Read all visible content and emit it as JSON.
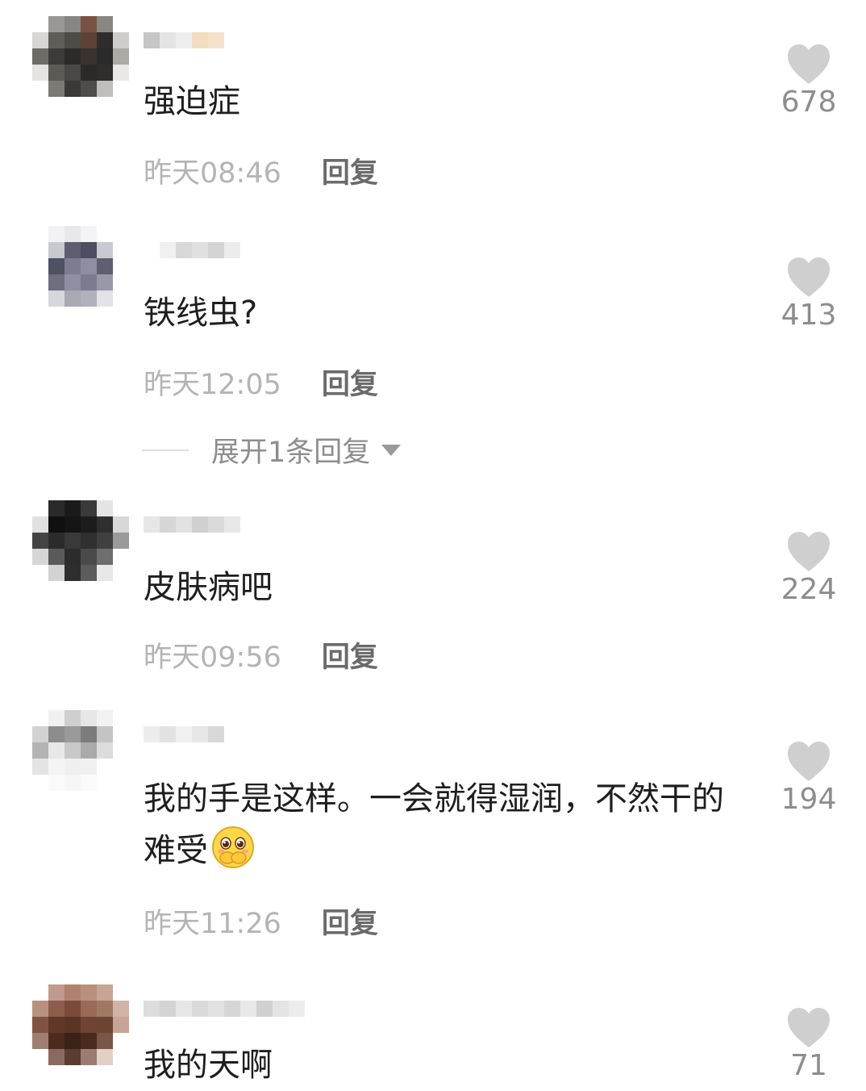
{
  "comments": [
    {
      "text": "强迫症",
      "time": "昨天08:46",
      "reply_label": "回复",
      "likes": "678",
      "avatar_colors": [
        "#ffffff",
        "#9a9895",
        "#888682",
        "#7a5244",
        "#8a8782",
        "#ffffff",
        "#d8d6d2",
        "#5f5d58",
        "#4d4b46",
        "#5e4237",
        "#2e2d2b",
        "#cfcdca",
        "#6f6c66",
        "#3d3b37",
        "#2c2b28",
        "#3a3230",
        "#2a2a2a",
        "#adaaa6",
        "#e6e4e2",
        "#5c5a55",
        "#4a4845",
        "#2b2a29",
        "#2f2e2d",
        "#e9e8e6",
        "#ffffff",
        "#7d7a75",
        "#3a3937",
        "#4f4d4a",
        "#c0beba",
        "#ffffff",
        "#ffffff",
        "#ffffff",
        "#ffffff",
        "#ffffff",
        "#ffffff",
        "#ffffff"
      ],
      "name_colors": [
        "#c7c6c6",
        "#e4e4e4",
        "#eeeeee",
        "#f4dcc0",
        "#f6e2cb"
      ]
    },
    {
      "text": "铁线虫?",
      "time": "昨天12:05",
      "reply_label": "回复",
      "likes": "413",
      "avatar_colors": [
        "#ffffff",
        "#f2f2f4",
        "#e8e8ec",
        "#f4f4f6",
        "#ffffff",
        "#ffffff",
        "#ffffff",
        "#c8c8d0",
        "#5c5d6e",
        "#4d4f60",
        "#c9c9d1",
        "#ffffff",
        "#ffffff",
        "#4e5064",
        "#7c7d8e",
        "#8d8ea0",
        "#5e6072",
        "#ffffff",
        "#ffffff",
        "#6d6e80",
        "#8e8fa0",
        "#7b7c90",
        "#9899a8",
        "#ffffff",
        "#ffffff",
        "#d6d6dd",
        "#a9a9b6",
        "#b1b1bd",
        "#e2e2e8",
        "#ffffff",
        "#ffffff",
        "#ffffff",
        "#ffffff",
        "#ffffff",
        "#ffffff",
        "#ffffff"
      ],
      "name_colors": [
        "#ffffff",
        "#f0f0f0",
        "#d8d8d8",
        "#e0e0e0",
        "#d4d4d4",
        "#ececec"
      ]
    },
    {
      "text": "皮肤病吧",
      "time": "昨天09:56",
      "reply_label": "回复",
      "likes": "224",
      "avatar_colors": [
        "#ffffff",
        "#2a2a2a",
        "#1a1a1a",
        "#3a3a3a",
        "#e4e4e4",
        "#ffffff",
        "#e1e1e1",
        "#101010",
        "#151515",
        "#1c1c1c",
        "#2f2f2f",
        "#d8d8d8",
        "#444444",
        "#2b2b2b",
        "#3a3a3a",
        "#303030",
        "#404040",
        "#9a9a9a",
        "#d6d6d6",
        "#5a5a5a",
        "#2c2c2c",
        "#4a4a4a",
        "#6e6e6e",
        "#ffffff",
        "#ffffff",
        "#d2d2d2",
        "#2e2e2e",
        "#5c5c5c",
        "#e8e8e8",
        "#ffffff",
        "#ffffff",
        "#ffffff",
        "#ffffff",
        "#ffffff",
        "#ffffff",
        "#ffffff"
      ],
      "name_colors": [
        "#e6e6e6",
        "#d6d6d6",
        "#e2e2e2",
        "#d0d0d0",
        "#dadada",
        "#e8e8e8"
      ]
    },
    {
      "text": "我的手是这样。一会就得湿润，不然干的难受",
      "time": "昨天11:26",
      "reply_label": "回复",
      "likes": "194",
      "avatar_colors": [
        "#ffffff",
        "#f0f0f0",
        "#cfcfcf",
        "#e6e6e6",
        "#f2f2f2",
        "#ffffff",
        "#d2d2d2",
        "#8c8c8c",
        "#9a9a9a",
        "#7c7c7c",
        "#c4c4c4",
        "#ffffff",
        "#b4b4b4",
        "#e8e8e8",
        "#c8c8c8",
        "#aaaaaa",
        "#dcdcdc",
        "#ffffff",
        "#e4e4e4",
        "#f4f4f4",
        "#efefef",
        "#f0f0f0",
        "#ffffff",
        "#ffffff",
        "#ffffff",
        "#fafafa",
        "#f6f6f6",
        "#fafafa",
        "#ffffff",
        "#ffffff",
        "#ffffff",
        "#ffffff",
        "#ffffff",
        "#ffffff",
        "#ffffff",
        "#ffffff"
      ],
      "name_colors": [
        "#ececec",
        "#e2e2e2",
        "#f0f0f0",
        "#e6e6e6",
        "#d8d8d8"
      ]
    },
    {
      "text": "我的天啊",
      "time": "",
      "reply_label": "",
      "likes": "71",
      "avatar_colors": [
        "#ffffff",
        "#c09a8c",
        "#b08070",
        "#b8907e",
        "#c8a494",
        "#ffffff",
        "#b9917f",
        "#8c5c4c",
        "#7a4a3a",
        "#9a6a58",
        "#a07866",
        "#d0b4a8",
        "#805444",
        "#603828",
        "#5a3424",
        "#704434",
        "#6c4434",
        "#c8a496",
        "#a07e70",
        "#4c2a1e",
        "#3a2218",
        "#4a2a1e",
        "#7a5646",
        "#ffffff",
        "#ffffff",
        "#8a6a5e",
        "#5a3c30",
        "#9a7c70",
        "#e0d0c8",
        "#ffffff",
        "#ffffff",
        "#ffffff",
        "#ffffff",
        "#ffffff",
        "#ffffff",
        "#ffffff"
      ],
      "name_colors": [
        "#dcdcdc",
        "#d4d4d4",
        "#e6e6e6",
        "#dadada",
        "#e2e2e2",
        "#d6d6d6",
        "#e8e8e8",
        "#d0d0d0",
        "#e4e4e4",
        "#ececec"
      ]
    }
  ],
  "expand_replies": {
    "label": "展开1条回复"
  },
  "colors": {
    "heart": "#cfcfcf",
    "like_count": "#8d8d8d",
    "time": "#b4b4b4",
    "reply": "#6a6a6a"
  },
  "icons": {
    "like": "heart-icon",
    "expand": "caret-down-icon",
    "emoji": "shy-face-emoji"
  }
}
